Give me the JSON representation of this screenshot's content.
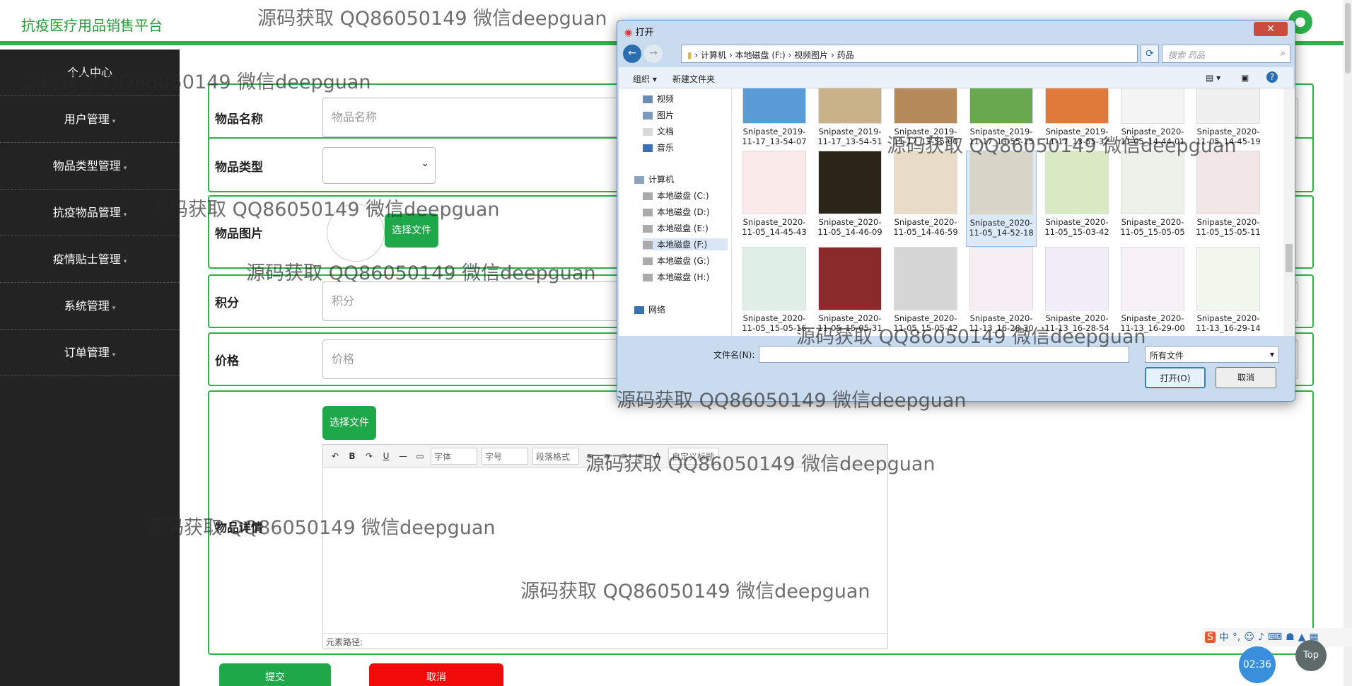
{
  "header": {
    "brand": "抗疫医疗用品销售平台"
  },
  "sidebar": {
    "items": [
      {
        "label": "个人中心"
      },
      {
        "label": "用户管理"
      },
      {
        "label": "物品类型管理"
      },
      {
        "label": "抗疫物品管理"
      },
      {
        "label": "疫情贴士管理"
      },
      {
        "label": "系统管理"
      },
      {
        "label": "订单管理"
      }
    ]
  },
  "form": {
    "name_label": "物品名称",
    "name_placeholder": "物品名称",
    "type_label": "物品类型",
    "image_label": "物品图片",
    "choose_file": "选择文件",
    "points_label": "积分",
    "points_placeholder": "积分",
    "price_label": "价格",
    "price_placeholder": "价格",
    "detail_label": "物品详情",
    "detail_choose_file": "选择文件",
    "submit": "提交",
    "cancel": "取消"
  },
  "editor": {
    "font": "字体",
    "size": "字号",
    "paragraph": "段落格式",
    "custom_title": "自定义标题",
    "path_label": "元素路径:"
  },
  "dialog": {
    "title": "打开",
    "path": [
      "计算机",
      "本地磁盘 (F:)",
      "视频图片",
      "药品"
    ],
    "search_placeholder": "搜索 药品",
    "organize": "组织 ▾",
    "new_folder": "新建文件夹",
    "tree": [
      {
        "label": "视频"
      },
      {
        "label": "图片"
      },
      {
        "label": "文档"
      },
      {
        "label": "音乐"
      },
      {
        "label": "计算机"
      },
      {
        "label": "本地磁盘 (C:)"
      },
      {
        "label": "本地磁盘 (D:)"
      },
      {
        "label": "本地磁盘 (E:)"
      },
      {
        "label": "本地磁盘 (F:)"
      },
      {
        "label": "本地磁盘 (G:)"
      },
      {
        "label": "本地磁盘 (H:)"
      },
      {
        "label": "网络"
      }
    ],
    "files": [
      {
        "line1": "Snipaste_2019-",
        "line2": "11-17_13-54-07"
      },
      {
        "line1": "Snipaste_2019-",
        "line2": "11-17_13-54-51"
      },
      {
        "line1": "Snipaste_2019-",
        "line2": "11-17_13-55-00"
      },
      {
        "line1": "Snipaste_2019-",
        "line2": "11-17_13-55-15"
      },
      {
        "line1": "Snipaste_2019-",
        "line2": "11-17_13-55-32"
      },
      {
        "line1": "Snipaste_2020-",
        "line2": "11-05_14-44-01"
      },
      {
        "line1": "Snipaste_2020-",
        "line2": "11-05_14-45-19"
      },
      {
        "line1": "Snipaste_2020-",
        "line2": "11-05_14-45-43"
      },
      {
        "line1": "Snipaste_2020-",
        "line2": "11-05_14-46-09"
      },
      {
        "line1": "Snipaste_2020-",
        "line2": "11-05_14-46-59"
      },
      {
        "line1": "Snipaste_2020-",
        "line2": "11-05_14-52-18"
      },
      {
        "line1": "Snipaste_2020-",
        "line2": "11-05_15-03-42"
      },
      {
        "line1": "Snipaste_2020-",
        "line2": "11-05_15-05-05"
      },
      {
        "line1": "Snipaste_2020-",
        "line2": "11-05_15-05-11"
      },
      {
        "line1": "Snipaste_2020-",
        "line2": "11-05_15-05-16"
      },
      {
        "line1": "Snipaste_2020-",
        "line2": "11-05_15-05-31"
      },
      {
        "line1": "Snipaste_2020-",
        "line2": "11-05_15-05-42"
      },
      {
        "line1": "Snipaste_2020-",
        "line2": "11-13_16-28-30"
      },
      {
        "line1": "Snipaste_2020-",
        "line2": "11-13_16-28-54"
      },
      {
        "line1": "Snipaste_2020-",
        "line2": "11-13_16-29-00"
      },
      {
        "line1": "Snipaste_2020-",
        "line2": "11-13_16-29-14"
      }
    ],
    "filename_label": "文件名(N):",
    "filetype": "所有文件",
    "open_btn": "打开(O)",
    "cancel_btn": "取消"
  },
  "watermark": "源码获取 QQ86050149 微信deepguan",
  "taskbar": {
    "clock": "02:36",
    "top": "Top"
  }
}
